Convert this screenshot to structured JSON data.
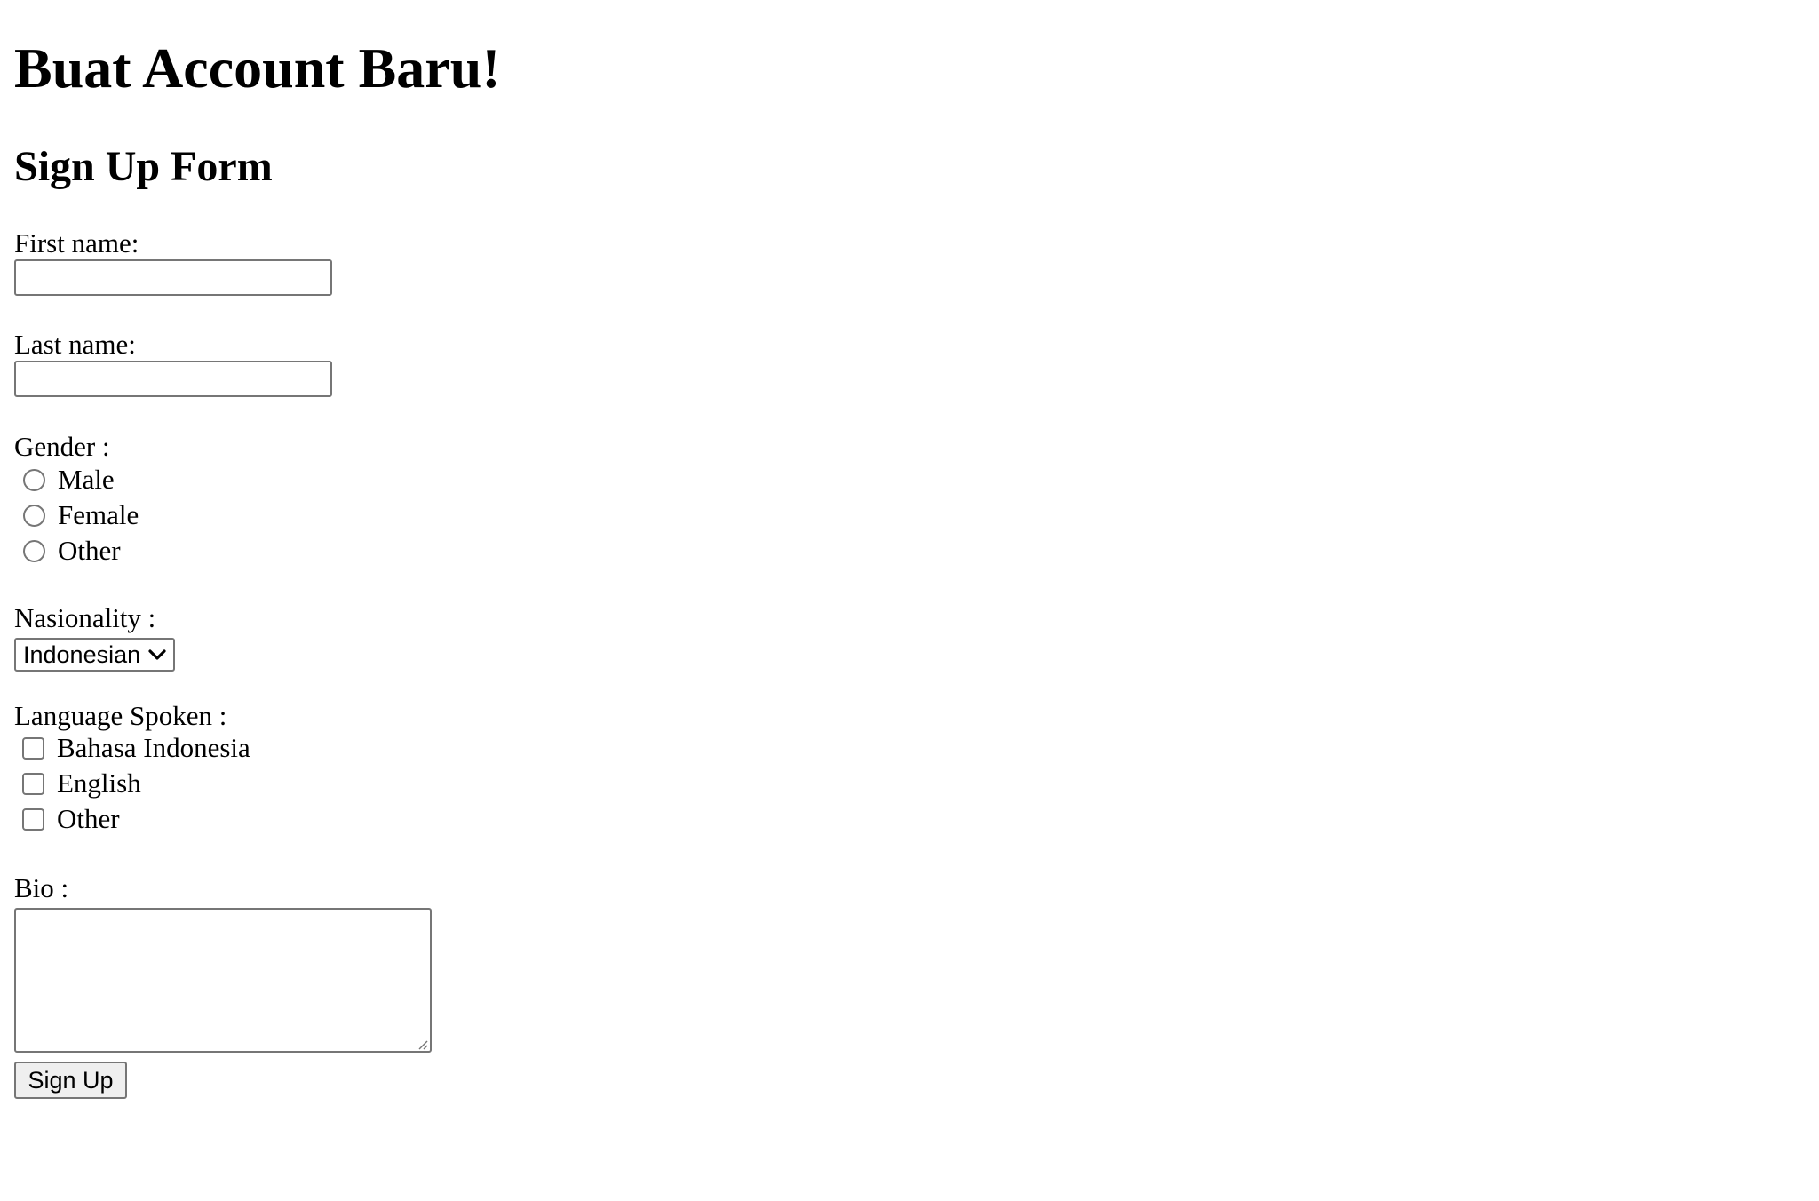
{
  "page": {
    "heading": "Buat Account Baru!",
    "subheading": "Sign Up Form"
  },
  "form": {
    "first_name": {
      "label": "First name:",
      "value": ""
    },
    "last_name": {
      "label": "Last name:",
      "value": ""
    },
    "gender": {
      "label": "Gender :",
      "options": [
        "Male",
        "Female",
        "Other"
      ],
      "selected": null
    },
    "nationality": {
      "label": "Nasionality :",
      "selected": "Indonesian"
    },
    "languages": {
      "label": "Language Spoken :",
      "options": [
        "Bahasa Indonesia",
        "English",
        "Other"
      ],
      "checked": []
    },
    "bio": {
      "label": "Bio :",
      "value": ""
    },
    "submit_label": "Sign Up"
  },
  "icons": {
    "select_arrow": "chevron-down-icon",
    "resize": "resize-grip-icon"
  }
}
